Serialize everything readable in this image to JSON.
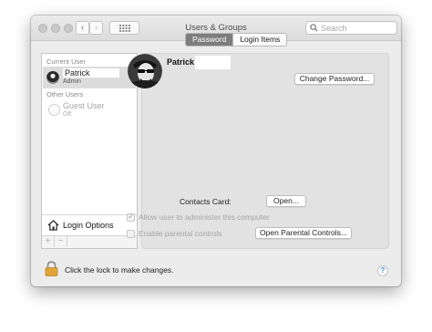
{
  "window": {
    "title": "Users & Groups",
    "search_placeholder": "Search"
  },
  "sidebar": {
    "current_user_label": "Current User",
    "current_user": {
      "name": "Patrick",
      "role": "Admin"
    },
    "other_users_label": "Other Users",
    "other_users": [
      {
        "name": "Guest User",
        "status": "Off"
      }
    ],
    "login_options_label": "Login Options",
    "add_label": "+",
    "remove_label": "−"
  },
  "tabs": [
    {
      "label": "Password",
      "active": true
    },
    {
      "label": "Login Items",
      "active": false
    }
  ],
  "profile": {
    "name": "Patrick",
    "change_password_label": "Change Password..."
  },
  "contacts": {
    "label": "Contacts Card:",
    "open_label": "Open..."
  },
  "options": {
    "allow_admin": {
      "label": "Allow user to administer this computer",
      "checked": true,
      "enabled": false
    },
    "parental": {
      "label": "Enable parental controls",
      "checked": false,
      "enabled": false
    },
    "open_parental_label": "Open Parental Controls..."
  },
  "footer": {
    "lock_text": "Click the lock to make changes.",
    "help_label": "?"
  },
  "colors": {
    "window_bg": "#ececec",
    "selected_tab": "#7d7d7d",
    "lock_gold": "#e0a63a"
  }
}
